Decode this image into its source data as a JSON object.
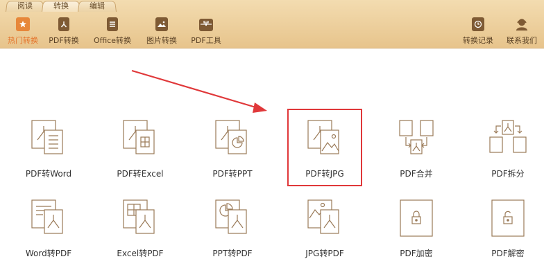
{
  "tabs": [
    {
      "label": "阅读",
      "active": false
    },
    {
      "label": "转换",
      "active": true
    },
    {
      "label": "编辑",
      "active": false
    }
  ],
  "toolbar_left": [
    {
      "label": "热门转换",
      "icon": "star-icon",
      "active": true
    },
    {
      "label": "PDF转换",
      "icon": "pdf-icon",
      "active": false
    },
    {
      "label": "Office转换",
      "icon": "document-icon",
      "active": false
    },
    {
      "label": "图片转换",
      "icon": "image-icon",
      "active": false
    },
    {
      "label": "PDF工具",
      "icon": "toolbox-icon",
      "active": false
    }
  ],
  "toolbar_right": [
    {
      "label": "转换记录",
      "icon": "clock-icon"
    },
    {
      "label": "联系我们",
      "icon": "support-icon"
    }
  ],
  "conversions_row1": [
    {
      "label": "PDF转Word",
      "icon": "pdf-to-word-icon"
    },
    {
      "label": "PDF转Excel",
      "icon": "pdf-to-excel-icon"
    },
    {
      "label": "PDF转PPT",
      "icon": "pdf-to-ppt-icon"
    },
    {
      "label": "PDF转JPG",
      "icon": "pdf-to-jpg-icon"
    },
    {
      "label": "PDF合并",
      "icon": "pdf-merge-icon"
    },
    {
      "label": "PDF拆分",
      "icon": "pdf-split-icon"
    }
  ],
  "conversions_row2": [
    {
      "label": "Word转PDF",
      "icon": "word-to-pdf-icon"
    },
    {
      "label": "Excel转PDF",
      "icon": "excel-to-pdf-icon"
    },
    {
      "label": "PPT转PDF",
      "icon": "ppt-to-pdf-icon"
    },
    {
      "label": "JPG转PDF",
      "icon": "jpg-to-pdf-icon"
    },
    {
      "label": "PDF加密",
      "icon": "pdf-encrypt-icon"
    },
    {
      "label": "PDF解密",
      "icon": "pdf-decrypt-icon"
    }
  ],
  "colors": {
    "ribbon_top": "#f3dcb0",
    "ribbon_bottom": "#e7c48c",
    "accent": "#e7873a",
    "icon_stroke": "#9a7a58",
    "highlight": "#e0383a"
  }
}
